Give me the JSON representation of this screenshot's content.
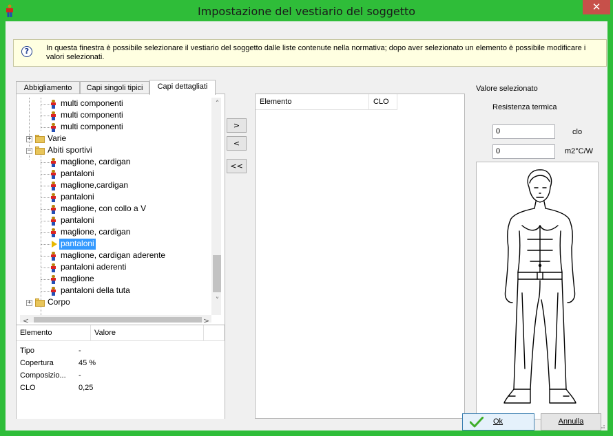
{
  "window": {
    "title": "Impostazione del vestiario del soggetto",
    "close_glyph": "✕",
    "title_bar_color": "#2fbd39"
  },
  "info": {
    "icon": "help-question-icon",
    "text": "In questa finestra è possibile selezionare il vestiario del soggetto dalle liste contenute nella normativa; dopo aver selezionato un elemento è possibile modificare i valori selezionati."
  },
  "tabs": [
    {
      "label": "Abbigliamento"
    },
    {
      "label": "Capi singoli tipici"
    },
    {
      "label": "Capi dettagliati"
    }
  ],
  "tree": {
    "items": [
      {
        "label": "multi componenti",
        "icon": "person-clothing-icon"
      },
      {
        "label": "multi componenti",
        "icon": "person-clothing-icon"
      },
      {
        "label": "multi componenti",
        "icon": "person-clothing-icon"
      },
      {
        "label": "Varie",
        "icon": "folder-icon",
        "expander": "+"
      },
      {
        "label": "Abiti sportivi",
        "icon": "folder-icon",
        "expander": "−"
      },
      {
        "label": "maglione, cardigan",
        "icon": "person-clothing-icon"
      },
      {
        "label": "pantaloni",
        "icon": "person-clothing-icon"
      },
      {
        "label": "maglione,cardigan",
        "icon": "person-clothing-icon"
      },
      {
        "label": "pantaloni",
        "icon": "person-clothing-icon"
      },
      {
        "label": "maglione, con collo a V",
        "icon": "person-clothing-icon"
      },
      {
        "label": "pantaloni",
        "icon": "person-clothing-icon"
      },
      {
        "label": "maglione, cardigan",
        "icon": "person-clothing-icon"
      },
      {
        "label": "pantaloni",
        "icon": "arrow-right-icon",
        "selected": true
      },
      {
        "label": "maglione, cardigan aderente",
        "icon": "person-clothing-icon"
      },
      {
        "label": "pantaloni aderenti",
        "icon": "person-clothing-icon"
      },
      {
        "label": "maglione",
        "icon": "person-clothing-icon"
      },
      {
        "label": "pantaloni della tuta",
        "icon": "person-clothing-icon"
      },
      {
        "label": "Corpo",
        "icon": "folder-icon",
        "expander": "+"
      }
    ],
    "scroll_up": "˄",
    "scroll_down": "˅",
    "scroll_left": "<",
    "scroll_right": ">"
  },
  "properties": {
    "headers": [
      "Elemento",
      "Valore"
    ],
    "rows": [
      {
        "label": "Tipo",
        "value": "-"
      },
      {
        "label": "Copertura",
        "value": "45 %"
      },
      {
        "label": "Composizio...",
        "value": "-"
      },
      {
        "label": "CLO",
        "value": "0,25"
      }
    ]
  },
  "transfer_buttons": {
    "add": ">",
    "remove": "<",
    "remove_all": "<<"
  },
  "selected_list": {
    "headers": [
      "Elemento",
      "CLO"
    ]
  },
  "right_panel": {
    "title": "Valore selezionato",
    "subtitle": "Resistenza termica",
    "clo_value": "0",
    "clo_unit": "clo",
    "m2_value": "0",
    "m2_unit": "m2°C/W"
  },
  "footer": {
    "ok_label": "Ok",
    "cancel_label": "Annulla"
  }
}
